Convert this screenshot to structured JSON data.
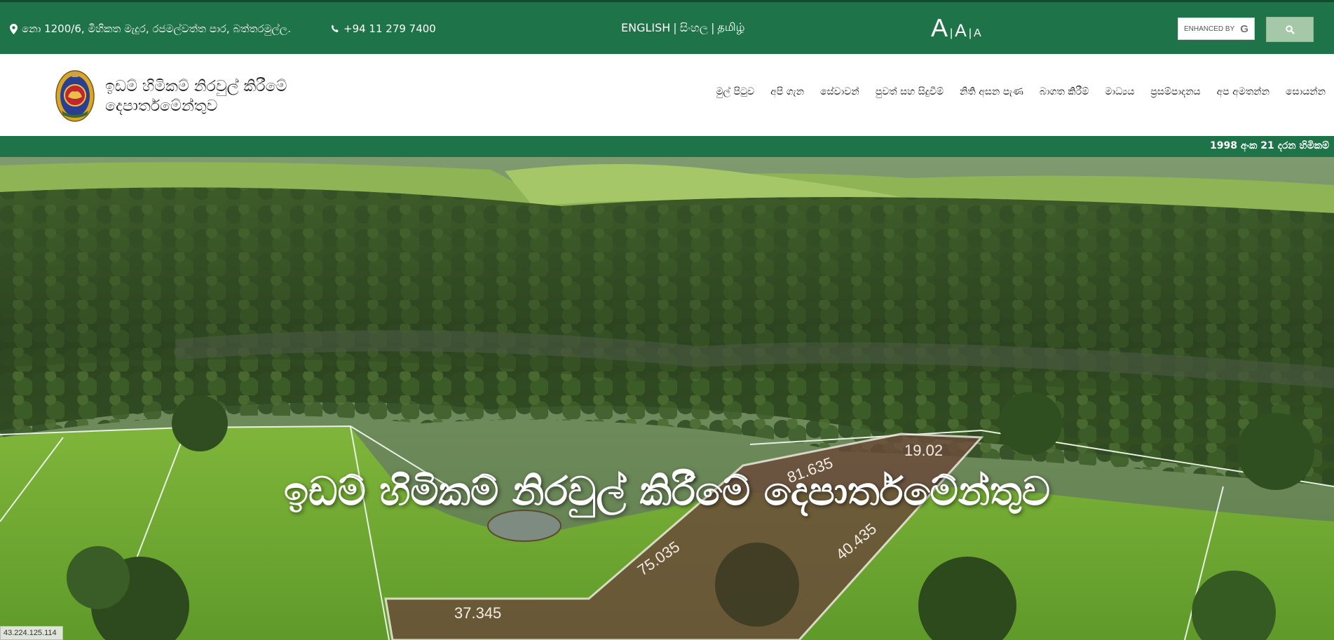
{
  "topbar": {
    "address": "නො 1200/6, මිහිකත මැදුර, රජමල්වත්ත පාර, බත්තරමුල්ල.",
    "phone": "+94 11 279 7400",
    "languages": [
      "ENGLISH",
      "සිංහල",
      "தமிழ்"
    ],
    "font_sizes": [
      "A",
      "A",
      "A"
    ],
    "search_placeholder": "ENHANCED BY",
    "search_logo": "G"
  },
  "header": {
    "brand_line1": "ඉඩම් හිමිකම් නිරවුල් කිරීමේ",
    "brand_line2": "දෙපාර්තමේන්තුව"
  },
  "nav": {
    "items": [
      "මුල් පිටුව",
      "අපි ගැන",
      "සේවාවන්",
      "පුවත් සහ සිදුවීම්",
      "නිති අසන පැණ",
      "බාගත කිරීම්",
      "මාධ්‍යය",
      "ප්‍රසම්පාදනය",
      "අප අමතන්න",
      "සොයන්න"
    ]
  },
  "ticker": {
    "text": "1998 අංක 21 දරන හිමිකම්"
  },
  "hero": {
    "title": "ඉඩම් හිමිකම් නිරවුල් කිරීමේ දෙපාර්තමේන්තුව",
    "plot_labels": [
      "19.02",
      "81.635",
      "40.435",
      "75.035",
      "37.345"
    ]
  },
  "ip_badge": "43.224.125.114",
  "colors": {
    "brand_green": "#1e7348",
    "search_button": "#a5c9a8"
  }
}
